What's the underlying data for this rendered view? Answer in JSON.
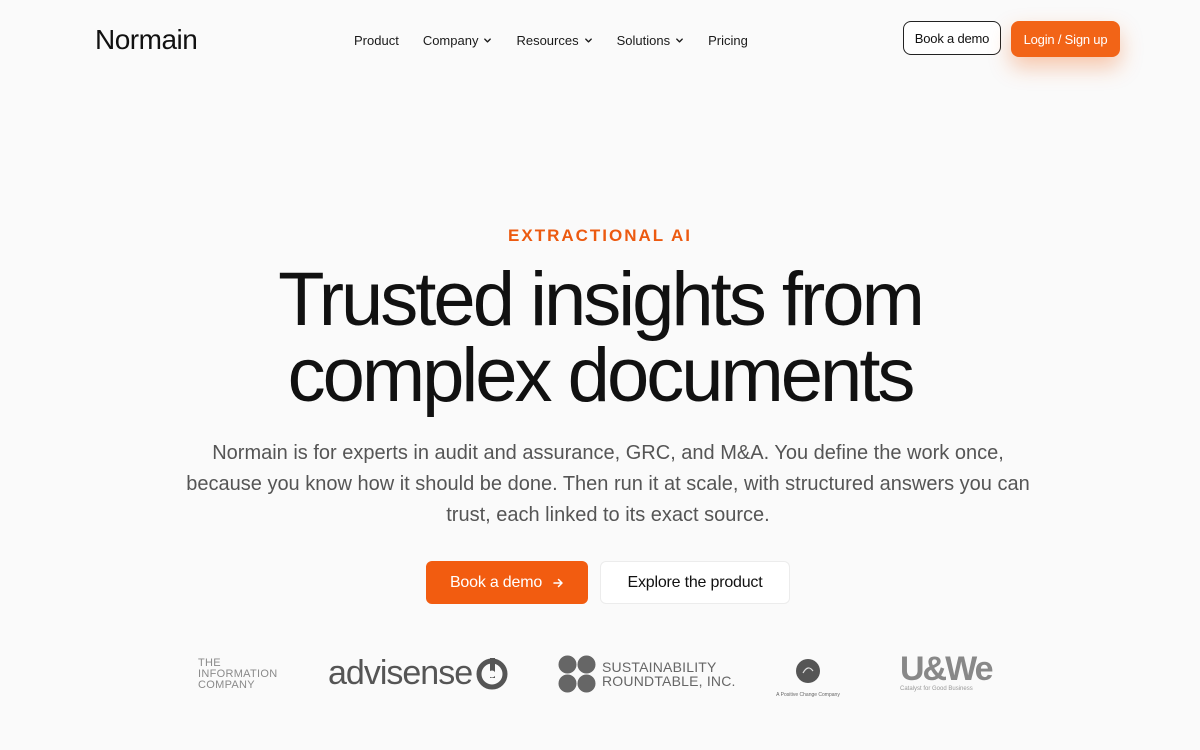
{
  "header": {
    "logo": "Normain",
    "nav": [
      {
        "label": "Product",
        "dropdown": false
      },
      {
        "label": "Company",
        "dropdown": true
      },
      {
        "label": "Resources",
        "dropdown": true
      },
      {
        "label": "Solutions",
        "dropdown": true
      },
      {
        "label": "Pricing",
        "dropdown": false
      }
    ],
    "book_demo_label": "Book a demo",
    "login_label": "Login / Sign up"
  },
  "hero": {
    "eyebrow": "EXTRACTIONAL AI",
    "headline_line1": "Trusted insights from",
    "headline_line2": "complex documents",
    "subtitle": "Normain is for experts in audit and assurance, GRC, and M&A. You define the work once, because you know how it should be done. Then run it at scale, with structured answers you can trust, each linked to its exact source.",
    "cta_primary": "Book a demo",
    "cta_secondary": "Explore the product"
  },
  "logos": {
    "info_line1": "THE",
    "info_line2": "INFORMATION",
    "info_line3": "COMPANY",
    "advisense": "advisense",
    "sustainability_line1": "SUSTAINABILITY",
    "sustainability_line2": "ROUNDTABLE, INC.",
    "positive_change": "A Positive Change Company",
    "uwe": "U&We",
    "uwe_tagline": "Catalyst for Good Business"
  },
  "colors": {
    "accent": "#f26417",
    "background": "#fafafa",
    "text": "#111111",
    "muted": "#555555"
  }
}
